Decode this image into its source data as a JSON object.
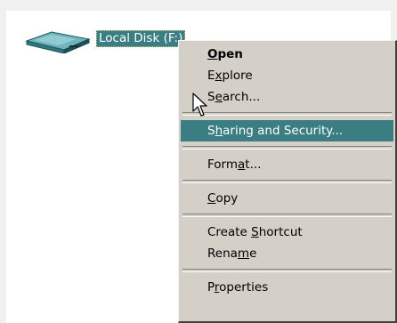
{
  "drive": {
    "label": "Local Disk (F:)",
    "icon": "drive-icon"
  },
  "menu": {
    "items": [
      {
        "pre": "",
        "key": "O",
        "post": "pen"
      },
      {
        "pre": "E",
        "key": "x",
        "post": "plore"
      },
      {
        "pre": "S",
        "key": "e",
        "post": "arch..."
      },
      {
        "pre": "S",
        "key": "h",
        "post": "aring and Security..."
      },
      {
        "pre": "Form",
        "key": "a",
        "post": "t..."
      },
      {
        "pre": "",
        "key": "C",
        "post": "opy"
      },
      {
        "pre": "Create ",
        "key": "S",
        "post": "hortcut"
      },
      {
        "pre": "Rena",
        "key": "m",
        "post": "e"
      },
      {
        "pre": "P",
        "key": "r",
        "post": "operties"
      }
    ]
  },
  "colors": {
    "highlight": "#3a7d82",
    "menu_bg": "#d4d0c8",
    "window_bg": "#ffffff"
  }
}
